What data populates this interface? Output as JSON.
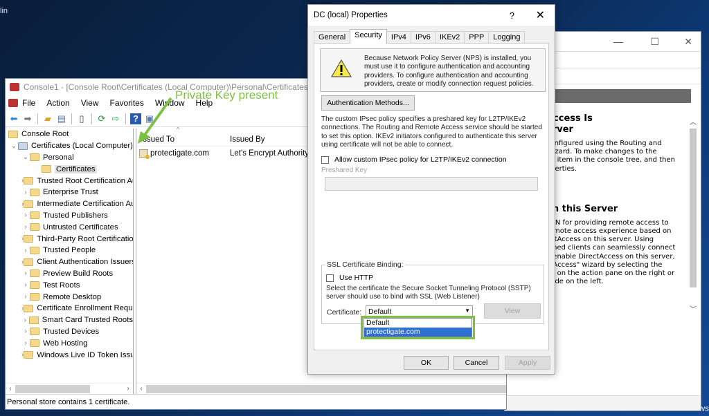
{
  "desktop": {
    "top_left_label": "lin",
    "watermark": "Windows"
  },
  "annotation": {
    "text": "Private Key present",
    "color": "#7dc142"
  },
  "console": {
    "title": "Console1 - [Console Root\\Certificates (Local Computer)\\Personal\\Certificates]",
    "menu": [
      "File",
      "Action",
      "View",
      "Favorites",
      "Window",
      "Help"
    ],
    "toolbar_icons": [
      "back-icon",
      "forward-icon",
      "up-folder-icon",
      "show-hide-tree-icon",
      "clipboard-icon",
      "refresh-icon",
      "export-list-icon",
      "help-icon",
      "action-pane-icon"
    ],
    "tree": {
      "root": "Console Root",
      "store": "Certificates (Local Computer)",
      "personal": "Personal",
      "selected": "Certificates",
      "folders": [
        "Trusted Root Certification Authorities",
        "Enterprise Trust",
        "Intermediate Certification Authorities",
        "Trusted Publishers",
        "Untrusted Certificates",
        "Third-Party Root Certification Authorities",
        "Trusted People",
        "Client Authentication Issuers",
        "Preview Build Roots",
        "Test Roots",
        "Remote Desktop",
        "Certificate Enrollment Requests",
        "Smart Card Trusted Roots",
        "Trusted Devices",
        "Web Hosting",
        "Windows Live ID Token Issuer"
      ]
    },
    "list": {
      "columns": [
        "Issued To",
        "Issued By"
      ],
      "rows": [
        {
          "issued_to": "protectigate.com",
          "issued_by": "Let's Encrypt Authority"
        }
      ]
    },
    "status": "Personal store contains 1 certificate."
  },
  "dialog": {
    "title": "DC (local) Properties",
    "help": "?",
    "close": "✕",
    "tabs": [
      "General",
      "Security",
      "IPv4",
      "IPv6",
      "IKEv2",
      "PPP",
      "Logging"
    ],
    "active_tab": "Security",
    "warning": "Because Network Policy Server (NPS) is installed, you must use it to configure authentication and accounting providers. To configure authentication and accounting providers, create or modify connection request policies.",
    "auth_button": "Authentication Methods...",
    "ipsec_text": "The custom IPsec policy specifies a preshared key for L2TP/IKEv2 connections. The Routing and Remote Access service should be started to set this option. IKEv2 initiators configured to authenticate this server using certificate will not be able to connect.",
    "ipsec_checkbox": {
      "label": "Allow custom IPsec policy for L2TP/IKEv2 connection",
      "checked": false
    },
    "preshared_key": {
      "label": "Preshared Key",
      "value": ""
    },
    "ssl": {
      "legend": "SSL Certificate Binding:",
      "use_http": {
        "label": "Use HTTP",
        "checked": false
      },
      "description": "Select the certificate the Secure Socket Tunneling Protocol (SSTP) server should use to bind with SSL (Web Listener)",
      "certificate_label": "Certificate:",
      "certificate_value": "Default",
      "options": [
        "Default",
        "protectigate.com"
      ],
      "highlighted_option": "protectigate.com",
      "view_button": "View"
    },
    "buttons": {
      "ok": "OK",
      "cancel": "Cancel",
      "apply": "Apply"
    }
  },
  "rras_window": {
    "heading1_line1": "Access Is",
    "heading1_line2": "erver",
    "para1": "configured using the Routing and Wizard. To make changes to the an item in the console tree, and then operties.",
    "para1_lines": [
      "configured using the Routing and",
      "Wizard. To make changes to the",
      "an item in the console tree, and then",
      "operties."
    ],
    "heading2": "on this Server",
    "para2_lines": [
      "VPN for providing remote access to",
      "remote access experience based on",
      "ectAccess on this server. Using",
      "bined clients can seamlessly connect",
      "o enable DirectAccess on this server,",
      "ctAccess\" wizard by selecting the",
      "on on the action pane on the right or",
      "node on the left."
    ]
  }
}
